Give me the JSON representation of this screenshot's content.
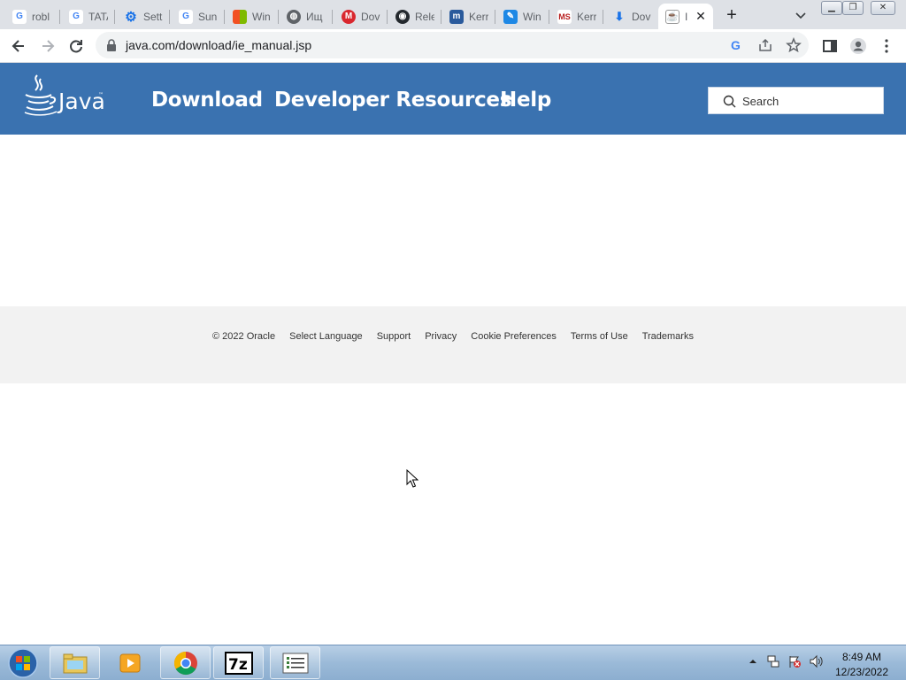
{
  "browser": {
    "tabs": [
      {
        "label": "robl",
        "icon": "google-icon"
      },
      {
        "label": "TATA",
        "icon": "google-icon"
      },
      {
        "label": "Sett",
        "icon": "gear-icon"
      },
      {
        "label": "Sun",
        "icon": "google-icon"
      },
      {
        "label": "Win",
        "icon": "microsoft-icon"
      },
      {
        "label": "Ищ",
        "icon": "globe-icon"
      },
      {
        "label": "Dov",
        "icon": "mega-icon"
      },
      {
        "label": "Rele",
        "icon": "github-icon"
      },
      {
        "label": "Kerr",
        "icon": "m-icon"
      },
      {
        "label": "Win",
        "icon": "pen-icon"
      },
      {
        "label": "Kerr",
        "icon": "ms-icon"
      },
      {
        "label": "Dov",
        "icon": "download-icon"
      },
      {
        "label": "I",
        "icon": "java-icon",
        "active": true
      }
    ],
    "url": "java.com/download/ie_manual.jsp"
  },
  "site": {
    "nav": {
      "download": "Download",
      "developer": "Developer Resources",
      "help": "Help"
    },
    "search_placeholder": "Search",
    "footer": {
      "copyright": "© 2022 Oracle",
      "select_language": "Select Language",
      "support": "Support",
      "privacy": "Privacy",
      "cookie": "Cookie Preferences",
      "terms": "Terms of Use",
      "trademarks": "Trademarks"
    }
  },
  "taskbar": {
    "time": "8:49 AM",
    "date": "12/23/2022"
  },
  "colors": {
    "java_header": "#3a72b0",
    "footer_bg": "#f2f2f2",
    "tabstrip": "#dee1e6"
  }
}
